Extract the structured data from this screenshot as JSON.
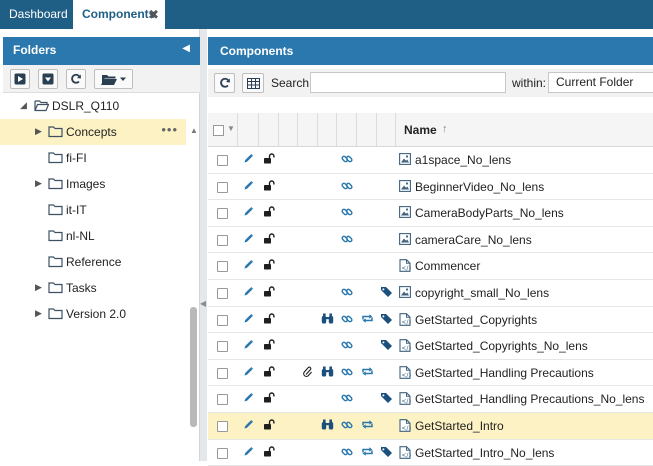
{
  "tabs": [
    {
      "label": "Dashboard",
      "active": false
    },
    {
      "label": "Components",
      "active": true,
      "close_icon": "close-icon"
    }
  ],
  "left_panel": {
    "title": "Folders",
    "toolbar": [
      {
        "icon": "play-square-icon"
      },
      {
        "icon": "down-square-icon"
      },
      {
        "icon": "refresh-icon"
      },
      {
        "icon": "folder-open-dropdown-icon"
      }
    ],
    "tree": [
      {
        "label": "DSLR_Q110",
        "expanded": true,
        "has_children": true
      },
      {
        "label": "Concepts",
        "has_children": true,
        "selected": true
      },
      {
        "label": "fi-FI",
        "has_children": false
      },
      {
        "label": "Images",
        "has_children": true
      },
      {
        "label": "it-IT",
        "has_children": false
      },
      {
        "label": "nl-NL",
        "has_children": false
      },
      {
        "label": "Reference",
        "has_children": false
      },
      {
        "label": "Tasks",
        "has_children": true
      },
      {
        "label": "Version 2.0",
        "has_children": true
      }
    ],
    "more_glyph": "•••"
  },
  "right_panel": {
    "title": "Components",
    "search_label": "Search:",
    "search_value": "",
    "within_label": "within:",
    "within_value": "Current Folder",
    "column_name": "Name",
    "sort_glyph": "↑",
    "accent": "#2a78ad",
    "selected_row_color": "#fdf2c4",
    "rows": [
      {
        "name": "a1space_No_lens",
        "type": "image",
        "attach": false,
        "binoculars": false,
        "link": true,
        "sync": false,
        "tag": false
      },
      {
        "name": "BeginnerVideo_No_lens",
        "type": "image",
        "attach": false,
        "binoculars": false,
        "link": true,
        "sync": false,
        "tag": false
      },
      {
        "name": "CameraBodyParts_No_lens",
        "type": "image",
        "attach": false,
        "binoculars": false,
        "link": true,
        "sync": false,
        "tag": false
      },
      {
        "name": "cameraCare_No_lens",
        "type": "image",
        "attach": false,
        "binoculars": false,
        "link": true,
        "sync": false,
        "tag": false
      },
      {
        "name": "Commencer",
        "type": "doc",
        "attach": false,
        "binoculars": false,
        "link": false,
        "sync": false,
        "tag": false
      },
      {
        "name": "copyright_small_No_lens",
        "type": "image",
        "attach": false,
        "binoculars": false,
        "link": true,
        "sync": false,
        "tag": true
      },
      {
        "name": "GetStarted_Copyrights",
        "type": "doc",
        "attach": false,
        "binoculars": true,
        "link": true,
        "sync": true,
        "tag": true
      },
      {
        "name": "GetStarted_Copyrights_No_lens",
        "type": "doc",
        "attach": false,
        "binoculars": false,
        "link": true,
        "sync": false,
        "tag": true
      },
      {
        "name": "GetStarted_Handling Precautions",
        "type": "doc",
        "attach": true,
        "binoculars": true,
        "link": true,
        "sync": true,
        "tag": false
      },
      {
        "name": "GetStarted_Handling Precautions_No_lens",
        "type": "doc",
        "attach": false,
        "binoculars": false,
        "link": true,
        "sync": false,
        "tag": true
      },
      {
        "name": "GetStarted_Intro",
        "type": "doc",
        "attach": false,
        "binoculars": true,
        "link": true,
        "sync": true,
        "tag": false,
        "selected": true
      },
      {
        "name": "GetStarted_Intro_No_lens",
        "type": "doc",
        "attach": false,
        "binoculars": false,
        "link": true,
        "sync": true,
        "tag": true
      }
    ]
  }
}
